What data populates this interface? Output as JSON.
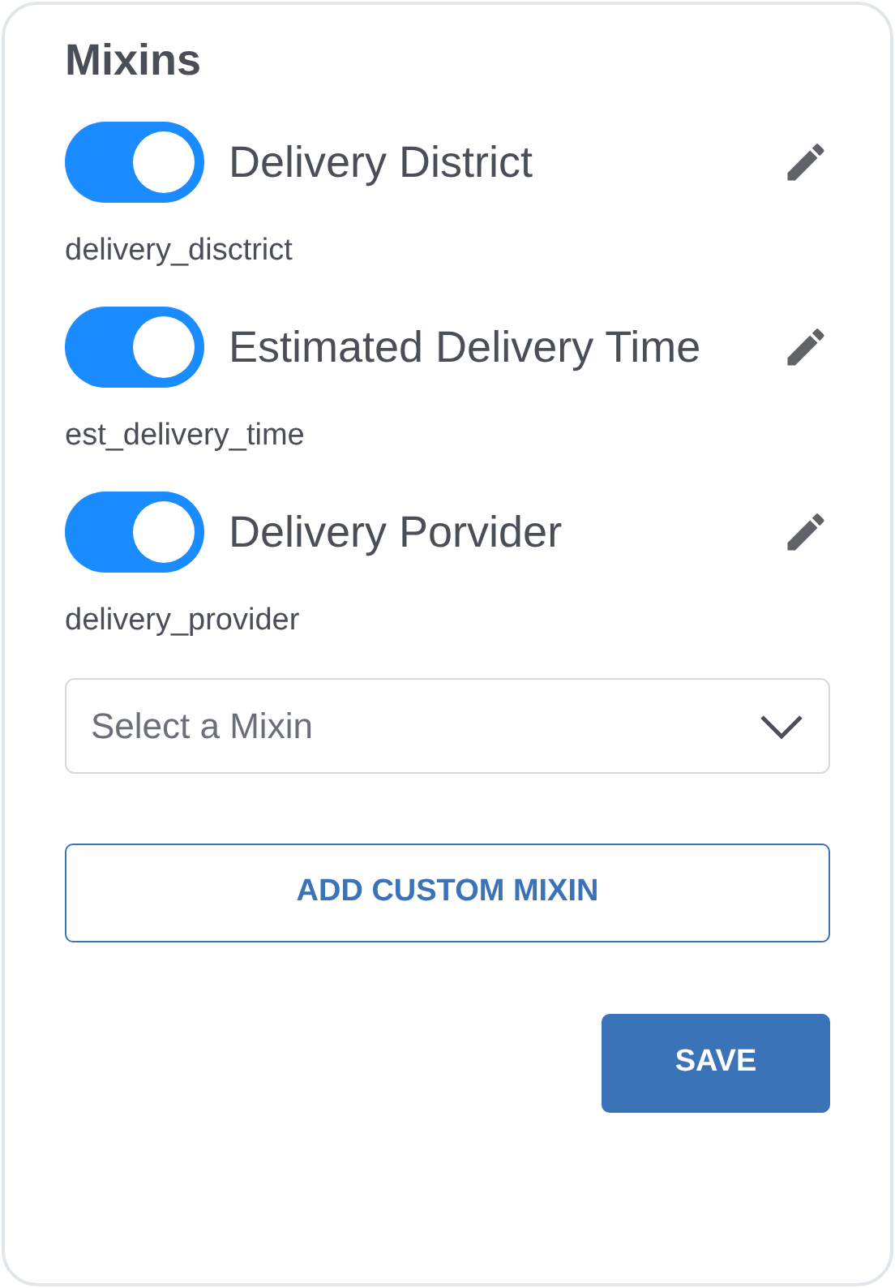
{
  "title": "Mixins",
  "mixins": [
    {
      "label": "Delivery District",
      "key": "delivery_disctrict",
      "on": true
    },
    {
      "label": "Estimated Delivery Time",
      "key": "est_delivery_time",
      "on": true
    },
    {
      "label": "Delivery Porvider",
      "key": "delivery_provider",
      "on": true
    }
  ],
  "select": {
    "placeholder": "Select a Mixin"
  },
  "add_button": "ADD CUSTOM MIXIN",
  "save_button": "SAVE"
}
